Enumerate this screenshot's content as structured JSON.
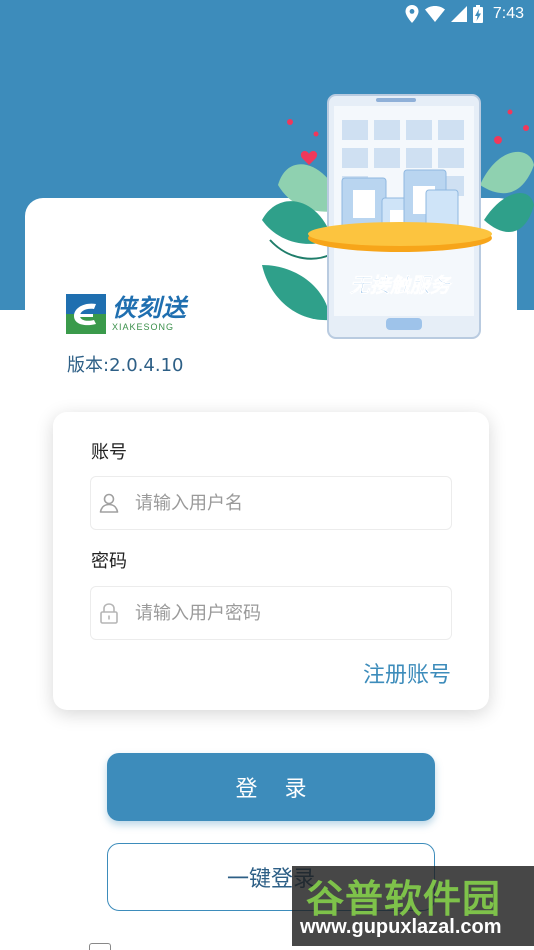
{
  "status_bar": {
    "time": "7:43"
  },
  "hero": {
    "banner_text": "无接触服务"
  },
  "logo": {
    "cn": "侠刻送",
    "en": "XIAKESONG"
  },
  "version": "版本:2.0.4.10",
  "form": {
    "account_label": "账号",
    "account_placeholder": "请输入用户名",
    "password_label": "密码",
    "password_placeholder": "请输入用户密码",
    "register_link": "注册账号"
  },
  "buttons": {
    "login": "登 录",
    "one_key_login": "一键登录"
  },
  "watermark": {
    "cn": "谷普软件园",
    "url": "www.gupuxlazal.com"
  },
  "colors": {
    "primary": "#3d8cbb",
    "watermark_green": "#7ec24a"
  }
}
